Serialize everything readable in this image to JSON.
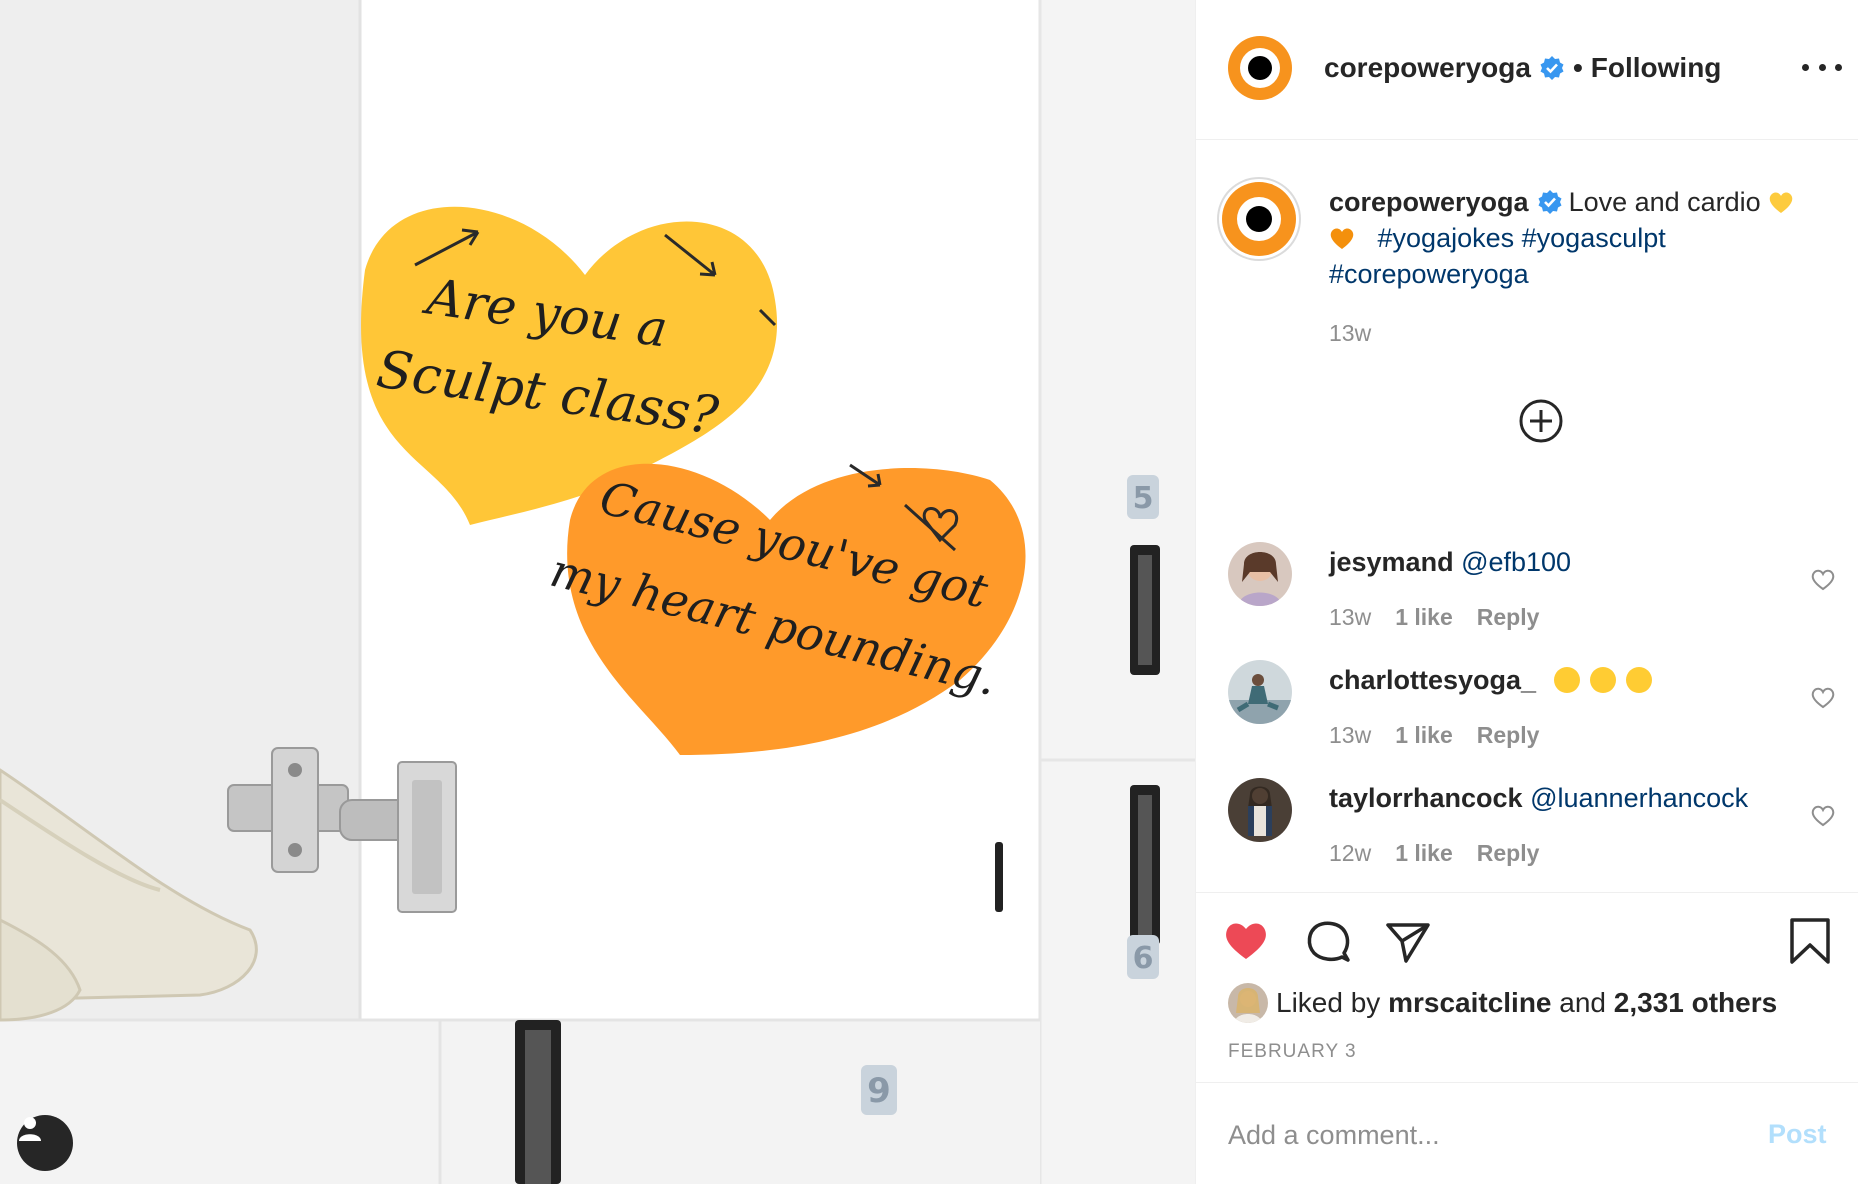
{
  "photo": {
    "note_yellow": [
      "Are you a",
      "Sculpt class?"
    ],
    "note_orange": [
      "Cause you've got",
      "my heart pounding."
    ],
    "locker_numbers": [
      "5",
      "6",
      "9"
    ]
  },
  "header": {
    "username": "corepoweryoga",
    "separator": "•",
    "follow_status": "Following"
  },
  "caption": {
    "username": "corepoweryoga",
    "text": "Love and cardio",
    "hashtags": [
      "#yogajokes",
      "#yogasculpt",
      "#corepoweryoga"
    ],
    "time": "13w"
  },
  "comments": [
    {
      "username": "jesymand",
      "mention": "@efb100",
      "time": "13w",
      "likes": "1 like",
      "reply": "Reply"
    },
    {
      "username": "charlottesyoga_",
      "mention": "",
      "time": "13w",
      "likes": "1 like",
      "reply": "Reply"
    },
    {
      "username": "taylorrhancock",
      "mention": "@luannerhancock",
      "time": "12w",
      "likes": "1 like",
      "reply": "Reply"
    }
  ],
  "likes": {
    "prefix": "Liked by",
    "first_user": "mrscaitcline",
    "conjunction": "and",
    "others": "2,331 others"
  },
  "date": "FEBRUARY 3",
  "comment_box": {
    "placeholder": "Add a comment...",
    "post_label": "Post"
  },
  "colors": {
    "brand_orange": "#f7931d",
    "heart_red": "#ed4956",
    "link_blue": "#00376b",
    "verified_blue": "#3897f0",
    "post_disabled": "#b2dffc",
    "note_yellow": "#ffc637",
    "note_orange": "#ff9a2a"
  },
  "icons": [
    "verified-badge-icon",
    "more-options-icon",
    "plus-circle-icon",
    "heart-outline-icon",
    "heart-filled-icon",
    "comment-bubble-icon",
    "share-paper-plane-icon",
    "bookmark-icon",
    "user-silhouette-icon"
  ]
}
